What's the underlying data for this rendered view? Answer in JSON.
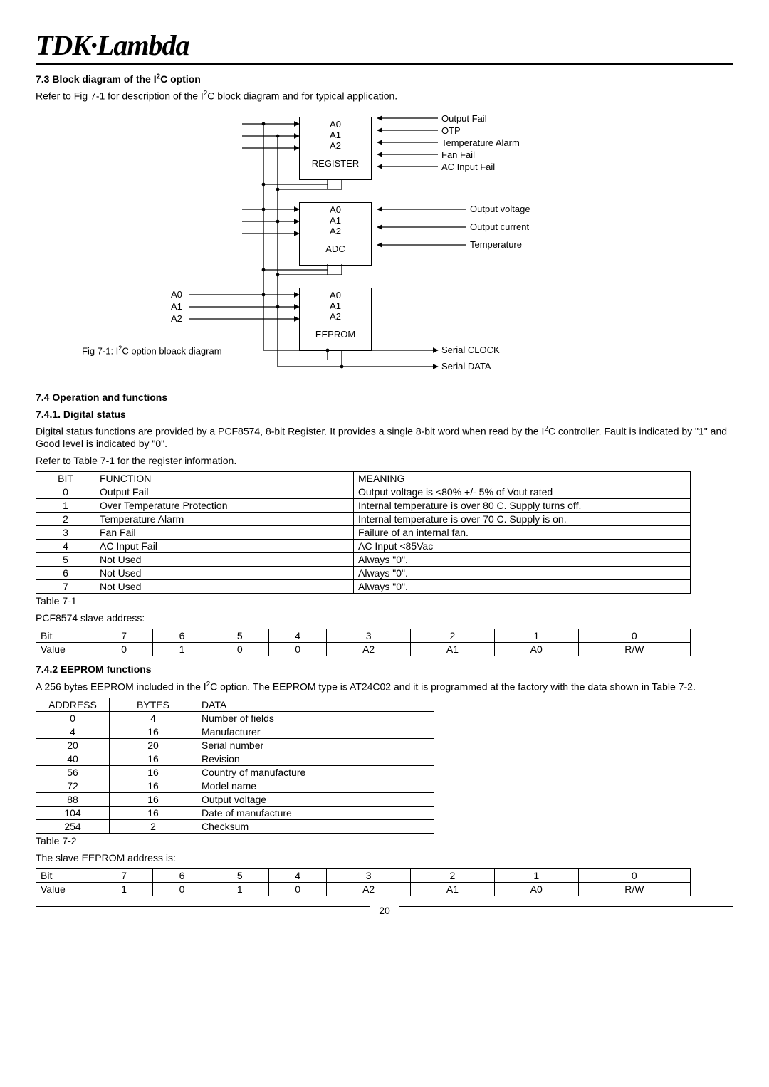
{
  "brand": "TDK·Lambda",
  "s73": {
    "head": "7.3 Block diagram of the I2C option",
    "text": "Refer to Fig 7-1 for description of the I2C block diagram and for typical application."
  },
  "diagram": {
    "register": {
      "pins": [
        "A0",
        "A1",
        "A2"
      ],
      "label": "REGISTER",
      "right": [
        "Output Fail",
        "OTP",
        "Temperature Alarm",
        "Fan Fail",
        "AC Input Fail"
      ]
    },
    "adc": {
      "pins": [
        "A0",
        "A1",
        "A2"
      ],
      "label": "ADC",
      "right": [
        "Output voltage",
        "Output current",
        "Temperature"
      ]
    },
    "eeprom": {
      "pins_left_ext": [
        "A0",
        "A1",
        "A2"
      ],
      "pins": [
        "A0",
        "A1",
        "A2"
      ],
      "label": "EEPROM"
    },
    "bus": [
      "Serial CLOCK",
      "Serial DATA"
    ],
    "caption": "Fig 7-1: I2C option bloack diagram"
  },
  "s74": {
    "head": "7.4 Operation and functions",
    "s741_head": "7.4.1. Digital status",
    "s741_p1": "Digital status functions are provided by a PCF8574, 8-bit Register.  It provides a single 8-bit word when read by the I2C controller. Fault is indicated by \"1\" and Good level is indicated by \"0\".",
    "s741_p2": "Refer to Table 7-1 for the register information.",
    "regtable": {
      "headers": [
        "BIT",
        "FUNCTION",
        "MEANING"
      ],
      "rows": [
        [
          "0",
          "Output Fail",
          "Output voltage is <80% +/- 5% of Vout rated"
        ],
        [
          "1",
          "Over Temperature Protection",
          "Internal temperature is over 80 C. Supply turns off."
        ],
        [
          "2",
          "Temperature Alarm",
          "Internal temperature is over 70 C. Supply is on."
        ],
        [
          "3",
          "Fan Fail",
          "Failure of an internal fan."
        ],
        [
          "4",
          "AC Input Fail",
          "AC Input <85Vac"
        ],
        [
          "5",
          "Not Used",
          "Always \"0\"."
        ],
        [
          "6",
          "Not Used",
          "Always \"0\"."
        ],
        [
          "7",
          "Not Used",
          "Always \"0\"."
        ]
      ],
      "caption": "Table 7-1"
    },
    "pcf_addr_label": "PCF8574 slave address:",
    "pcf_addr": {
      "bit": [
        "Bit",
        "7",
        "6",
        "5",
        "4",
        "3",
        "2",
        "1",
        "0"
      ],
      "value": [
        "Value",
        "0",
        "1",
        "0",
        "0",
        "A2",
        "A1",
        "A0",
        "R/W"
      ]
    },
    "s742_head": "7.4.2 EEPROM functions",
    "s742_p": "A 256 bytes EEPROM included in the I2C option. The EEPROM type is AT24C02 and it is programmed at the factory with the data shown in Table 7-2.",
    "eeptable": {
      "headers": [
        "ADDRESS",
        "BYTES",
        "DATA"
      ],
      "rows": [
        [
          "0",
          "4",
          "Number of fields"
        ],
        [
          "4",
          "16",
          "Manufacturer"
        ],
        [
          "20",
          "20",
          "Serial number"
        ],
        [
          "40",
          "16",
          "Revision"
        ],
        [
          "56",
          "16",
          "Country of manufacture"
        ],
        [
          "72",
          "16",
          "Model name"
        ],
        [
          "88",
          "16",
          "Output voltage"
        ],
        [
          "104",
          "16",
          "Date of manufacture"
        ],
        [
          "254",
          "2",
          "Checksum"
        ]
      ],
      "caption": "Table 7-2"
    },
    "eep_addr_label": "The slave EEPROM address is:",
    "eep_addr": {
      "bit": [
        "Bit",
        "7",
        "6",
        "5",
        "4",
        "3",
        "2",
        "1",
        "0"
      ],
      "value": [
        "Value",
        "1",
        "0",
        "1",
        "0",
        "A2",
        "A1",
        "A0",
        "R/W"
      ]
    }
  },
  "page_number": "20"
}
